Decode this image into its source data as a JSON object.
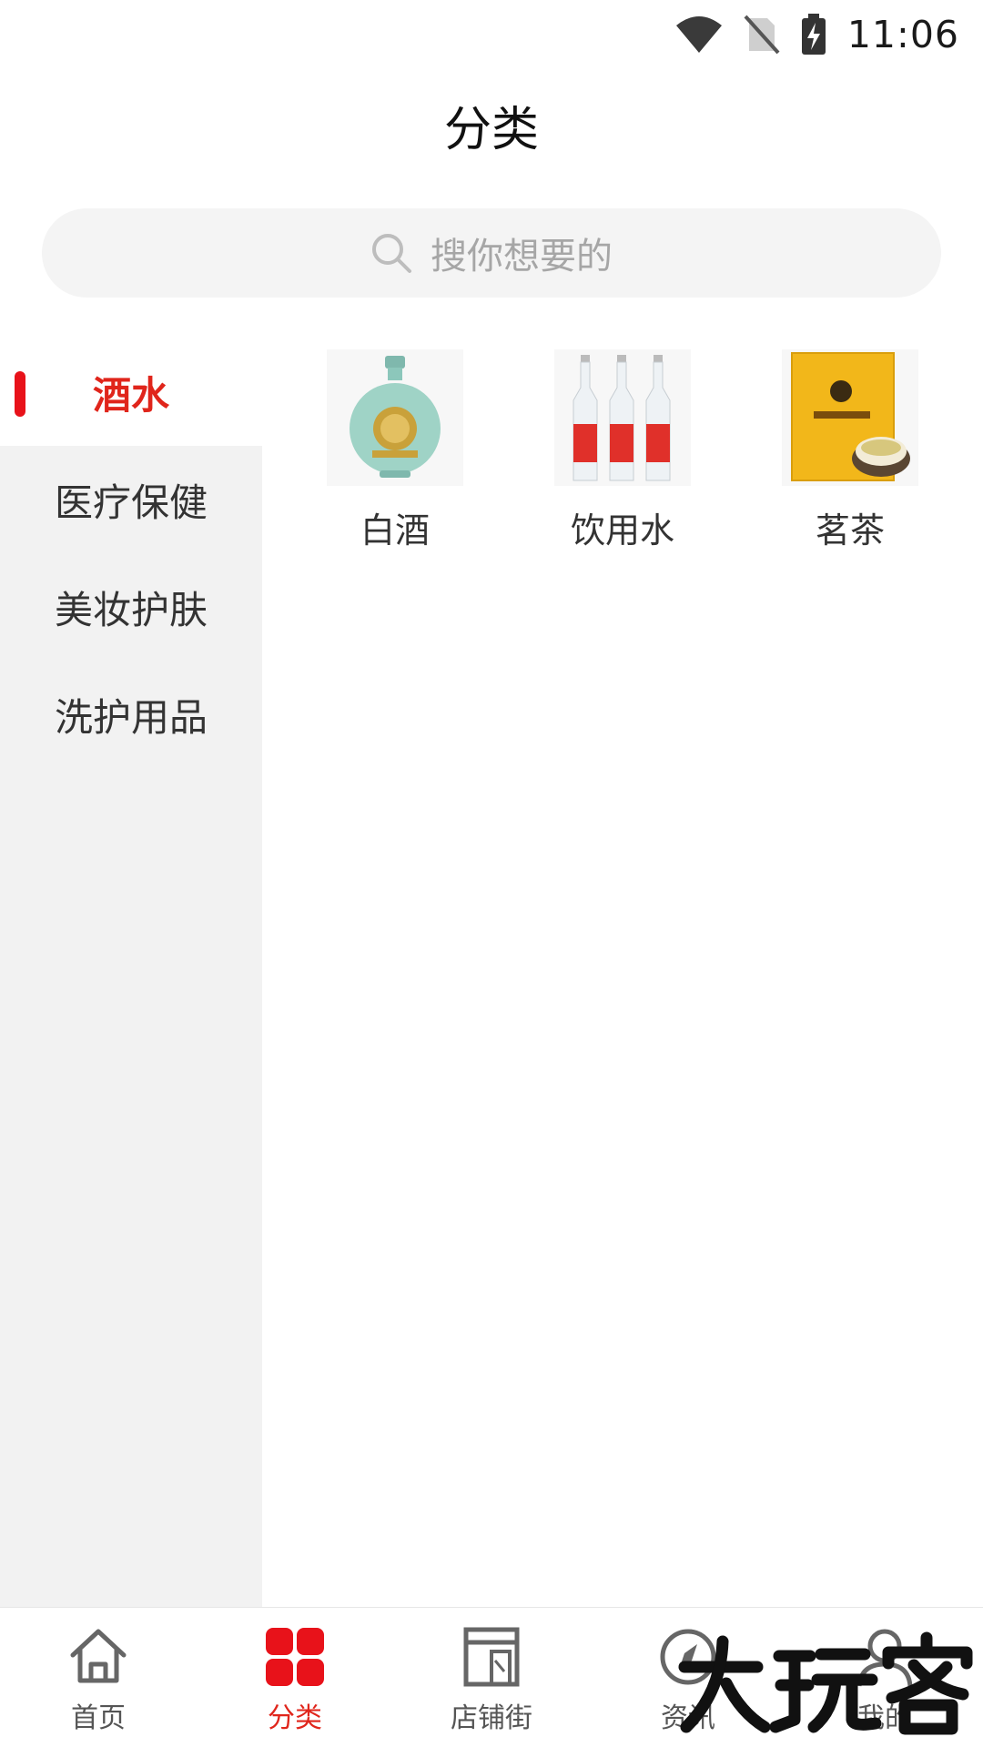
{
  "status_bar": {
    "time": "11:06"
  },
  "header": {
    "title": "分类"
  },
  "search": {
    "placeholder": "搜你想要的"
  },
  "sidebar": {
    "items": [
      {
        "label": "酒水",
        "active": true
      },
      {
        "label": "医疗保健",
        "active": false
      },
      {
        "label": "美妆护肤",
        "active": false
      },
      {
        "label": "洗护用品",
        "active": false
      }
    ]
  },
  "categories": [
    {
      "label": "白酒",
      "icon": "baijiu-bottle-image"
    },
    {
      "label": "饮用水",
      "icon": "water-bottles-image"
    },
    {
      "label": "茗茶",
      "icon": "tea-box-image"
    }
  ],
  "bottom_nav": {
    "items": [
      {
        "label": "首页",
        "icon": "home-icon",
        "active": false
      },
      {
        "label": "分类",
        "icon": "category-grid-icon",
        "active": true
      },
      {
        "label": "店铺街",
        "icon": "store-icon",
        "active": false
      },
      {
        "label": "资讯",
        "icon": "compass-icon",
        "active": false
      },
      {
        "label": "我的",
        "icon": "user-icon",
        "active": false
      }
    ]
  },
  "colors": {
    "accent": "#e0251b",
    "sidebar_bg": "#f2f2f2",
    "search_bg": "#f4f4f4"
  }
}
